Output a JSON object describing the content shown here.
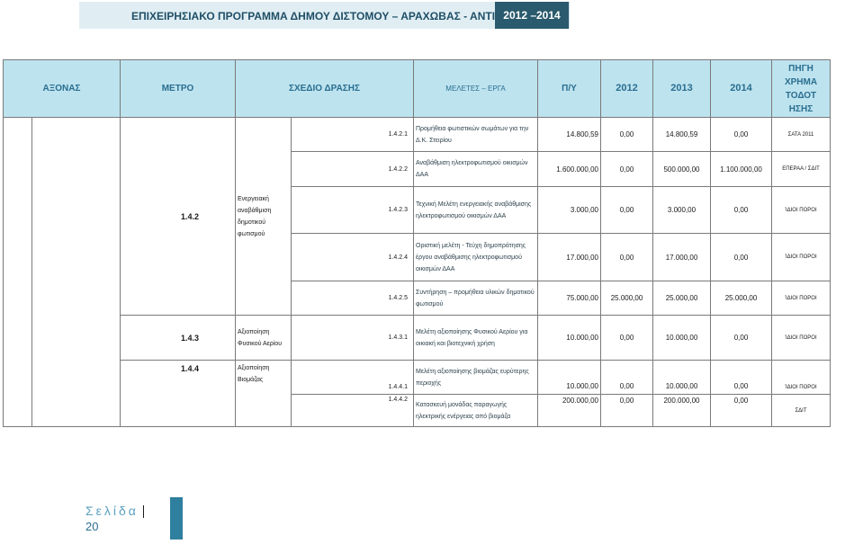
{
  "banner": {
    "title": "ΕΠΙΧΕΙΡΗΣΙΑΚΟ ΠΡΟΓΡΑΜΜΑ ΔΗΜΟΥ ΔΙΣΤΟΜΟΥ – ΑΡΑΧΩΒΑΣ - ΑΝΤΙΚΥΡΑΣ",
    "years": "2012 –2014"
  },
  "headers": {
    "axonas": "ΑΞΟΝΑΣ",
    "metro": "ΜΕΤΡΟ",
    "sxedio": "ΣΧΕΔΙΟ ΔΡΑΣΗΣ",
    "meletes": "ΜΕΛΕΤΕΣ – ΕΡΓΑ",
    "py": "Π/Υ",
    "y2012": "2012",
    "y2013": "2013",
    "y2014": "2014",
    "pigi": "ΠΗΓΗ ΧΡΗΜΑ ΤΟΔΟΤ ΗΣΗΣ"
  },
  "groups": [
    {
      "code": "1.4.2",
      "title": "Ενεργειακή αναβάθμιση δημοτικού φωτισμού"
    },
    {
      "code": "1.4.3",
      "title": "Αξιοποίηση Φυσικού Αερίου"
    },
    {
      "code": "1.4.4",
      "title": "Αξιοποίηση Βιομάζας"
    }
  ],
  "rows": [
    {
      "code": "1.4.2.1",
      "desc": "Προμήθεια φωτιστικών σωμάτων για την Δ.Κ. Στειρίου",
      "py": "14.800,59",
      "y2012": "0,00",
      "y2013": "14.800,59",
      "y2014": "0,00",
      "source": "ΣΑΤΑ 2011"
    },
    {
      "code": "1.4.2.2",
      "desc": "Αναβάθμιση ηλεκτροφωτισμού οικισμών ΔΑΑ",
      "py": "1.600.000,00",
      "y2012": "0,00",
      "y2013": "500.000,00",
      "y2014": "1.100.000,00",
      "source": "ΕΠΕΡΑΑ / ΣΔΙΤ"
    },
    {
      "code": "1.4.2.3",
      "desc": "Τεχνική Μελέτη ενεργειακής αναβάθμισης ηλεκτροφωτισμού οικισμών ΔΑΑ",
      "py": "3.000,00",
      "y2012": "0,00",
      "y2013": "3.000,00",
      "y2014": "0,00",
      "source": "ΊΔΙΟΙ ΠΟΡΟΙ"
    },
    {
      "code": "1.4.2.4",
      "desc": "Οριστική μελέτη - Τεύχη δημοπράτησης έργου αναβάθμισης ηλεκτροφωτισμού οικισμών ΔΑΑ",
      "py": "17.000,00",
      "y2012": "0,00",
      "y2013": "17.000,00",
      "y2014": "0,00",
      "source": "ΊΔΙΟΙ ΠΟΡΟΙ"
    },
    {
      "code": "1.4.2.5",
      "desc": "Συντήρηση – προμήθεια υλικών δημοτικού φωτισμού",
      "py": "75.000,00",
      "y2012": "25.000,00",
      "y2013": "25.000,00",
      "y2014": "25.000,00",
      "source": "ΊΔΙΟΙ ΠΟΡΟΙ"
    },
    {
      "code": "1.4.3.1",
      "desc": "Μελέτη αξιοποίησης Φυσικού Αερίου για οικιακή και βιοτεχνική χρήση",
      "py": "10.000,00",
      "y2012": "0,00",
      "y2013": "10.000,00",
      "y2014": "0,00",
      "source": "ΊΔΙΟΙ ΠΟΡΟΙ"
    },
    {
      "code": "1.4.4.1",
      "desc": "Μελέτη αξιοποίησης βιομάζας ευρύτερης περιοχής",
      "py": "10.000,00",
      "y2012": "0,00",
      "y2013": "10.000,00",
      "y2014": "0,00",
      "source": "ΊΔΙΟΙ ΠΟΡΟΙ"
    },
    {
      "code": "1.4.4.2",
      "desc": "Κατασκευή μονάδας παραγωγής ηλεκτρικής ενέργειας από βιομάζα",
      "py": "200.000,00",
      "y2012": "0,00",
      "y2013": "200.000,00",
      "y2014": "0,00",
      "source": "ΣΔΙΤ"
    }
  ],
  "footer": {
    "label": "Σελίδα",
    "page": "20"
  }
}
